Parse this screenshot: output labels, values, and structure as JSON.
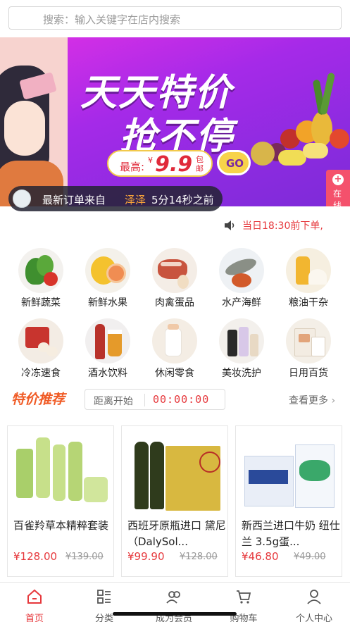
{
  "search": {
    "placeholder": "搜索：输入关键字在店内搜索"
  },
  "banner": {
    "title": "天天特价",
    "subtitle": "抢不停",
    "price_label": "最高:",
    "currency": "¥",
    "price_value": "9.9",
    "price_unit": "包邮",
    "go_label": "GO",
    "consult_label": "在线咨询",
    "latest_order_prefix": "最新订单来自",
    "latest_order_user": "泽泽",
    "latest_order_time": "5分14秒之前"
  },
  "notice": {
    "text": "当日18:30前下单,"
  },
  "categories": [
    {
      "label": "新鲜蔬菜",
      "icon": "vegetables-icon"
    },
    {
      "label": "新鲜水果",
      "icon": "fruit-icon"
    },
    {
      "label": "肉禽蛋品",
      "icon": "meat-icon"
    },
    {
      "label": "水产海鲜",
      "icon": "seafood-icon"
    },
    {
      "label": "粮油干杂",
      "icon": "grain-oil-icon"
    },
    {
      "label": "冷冻速食",
      "icon": "frozen-food-icon"
    },
    {
      "label": "酒水饮料",
      "icon": "drinks-icon"
    },
    {
      "label": "休闲零食",
      "icon": "snacks-icon"
    },
    {
      "label": "美妆洗护",
      "icon": "beauty-icon"
    },
    {
      "label": "日用百货",
      "icon": "daily-goods-icon"
    }
  ],
  "specials": {
    "title": "特价推荐",
    "countdown_label": "距离开始",
    "countdown_value": "00:00:00",
    "more_label": "查看更多",
    "products": [
      {
        "name": "百雀羚草本精粹套装",
        "price": "¥128.00",
        "old_price": "¥139.00"
      },
      {
        "name": "西班牙原瓶进口 黛尼（DalySol...",
        "price": "¥99.90",
        "old_price": "¥128.00"
      },
      {
        "name": "新西兰进口牛奶 纽仕兰 3.5g蛋...",
        "price": "¥46.80",
        "old_price": "¥49.00"
      }
    ]
  },
  "tabs": [
    {
      "label": "首页",
      "icon": "home-icon",
      "active": true
    },
    {
      "label": "分类",
      "icon": "category-icon",
      "active": false
    },
    {
      "label": "成为会员",
      "icon": "member-icon",
      "active": false
    },
    {
      "label": "购物车",
      "icon": "cart-icon",
      "active": false
    },
    {
      "label": "个人中心",
      "icon": "user-icon",
      "active": false
    }
  ],
  "colors": {
    "accent": "#e6383c",
    "banner_purple": "#8d2be0",
    "section_orange": "#f05a24"
  }
}
